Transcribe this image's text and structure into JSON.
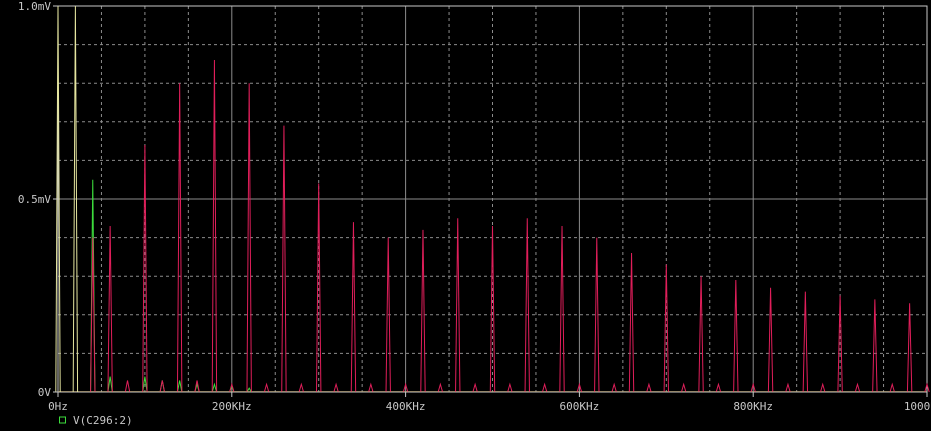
{
  "chart_data": {
    "type": "line",
    "title": "",
    "xlabel": "",
    "ylabel": "",
    "xlim": [
      0,
      1000
    ],
    "ylim": [
      0,
      1.0
    ],
    "x_unit": "KHz",
    "y_unit": "mV",
    "x_ticks": [
      "0Hz",
      "200KHz",
      "400KHz",
      "600KHz",
      "800KHz",
      "1000KHz"
    ],
    "y_ticks": [
      "0V",
      "0.5mV",
      "1.0mV"
    ],
    "grid": true,
    "background": "#000000",
    "axis_color": "#c8c8c8",
    "grid_color": "#8c8c8c",
    "legend": {
      "placement": "bottom-left",
      "entries": [
        {
          "label": "V(C296:2)",
          "color": "#3cdc3c"
        }
      ]
    },
    "series": [
      {
        "name": "V(C296:2)",
        "color": "#3cdc3c",
        "peaks": [
          {
            "x": 40,
            "y": 0.55
          },
          {
            "x": 60,
            "y": 0.04
          },
          {
            "x": 100,
            "y": 0.04
          },
          {
            "x": 120,
            "y": 0.03
          },
          {
            "x": 140,
            "y": 0.03
          },
          {
            "x": 160,
            "y": 0.02
          },
          {
            "x": 180,
            "y": 0.02
          },
          {
            "x": 200,
            "y": 0.015
          },
          {
            "x": 220,
            "y": 0.01
          }
        ]
      },
      {
        "color": "#e01e5a",
        "peaks": [
          {
            "x": 40,
            "y": 0.4
          },
          {
            "x": 60,
            "y": 0.43
          },
          {
            "x": 80,
            "y": 0.03
          },
          {
            "x": 100,
            "y": 0.64
          },
          {
            "x": 120,
            "y": 0.03
          },
          {
            "x": 140,
            "y": 0.8
          },
          {
            "x": 160,
            "y": 0.03
          },
          {
            "x": 180,
            "y": 0.86
          },
          {
            "x": 200,
            "y": 0.02
          },
          {
            "x": 220,
            "y": 0.8
          },
          {
            "x": 240,
            "y": 0.02
          },
          {
            "x": 260,
            "y": 0.69
          },
          {
            "x": 280,
            "y": 0.02
          },
          {
            "x": 300,
            "y": 0.54
          },
          {
            "x": 320,
            "y": 0.02
          },
          {
            "x": 340,
            "y": 0.44
          },
          {
            "x": 360,
            "y": 0.02
          },
          {
            "x": 380,
            "y": 0.4
          },
          {
            "x": 400,
            "y": 0.02
          },
          {
            "x": 420,
            "y": 0.42
          },
          {
            "x": 440,
            "y": 0.02
          },
          {
            "x": 460,
            "y": 0.45
          },
          {
            "x": 480,
            "y": 0.02
          },
          {
            "x": 500,
            "y": 0.43
          },
          {
            "x": 520,
            "y": 0.02
          },
          {
            "x": 540,
            "y": 0.45
          },
          {
            "x": 560,
            "y": 0.02
          },
          {
            "x": 580,
            "y": 0.43
          },
          {
            "x": 600,
            "y": 0.02
          },
          {
            "x": 620,
            "y": 0.4
          },
          {
            "x": 640,
            "y": 0.02
          },
          {
            "x": 660,
            "y": 0.36
          },
          {
            "x": 680,
            "y": 0.02
          },
          {
            "x": 700,
            "y": 0.33
          },
          {
            "x": 720,
            "y": 0.02
          },
          {
            "x": 740,
            "y": 0.3
          },
          {
            "x": 760,
            "y": 0.02
          },
          {
            "x": 780,
            "y": 0.29
          },
          {
            "x": 800,
            "y": 0.02
          },
          {
            "x": 820,
            "y": 0.27
          },
          {
            "x": 840,
            "y": 0.02
          },
          {
            "x": 860,
            "y": 0.26
          },
          {
            "x": 880,
            "y": 0.02
          },
          {
            "x": 900,
            "y": 0.25
          },
          {
            "x": 920,
            "y": 0.02
          },
          {
            "x": 940,
            "y": 0.24
          },
          {
            "x": 960,
            "y": 0.02
          },
          {
            "x": 980,
            "y": 0.23
          },
          {
            "x": 1000,
            "y": 0.02
          }
        ]
      },
      {
        "color": "#e6e6a0",
        "peaks": [
          {
            "x": 0,
            "y": 1.0
          },
          {
            "x": 20,
            "y": 1.0
          }
        ]
      }
    ]
  }
}
